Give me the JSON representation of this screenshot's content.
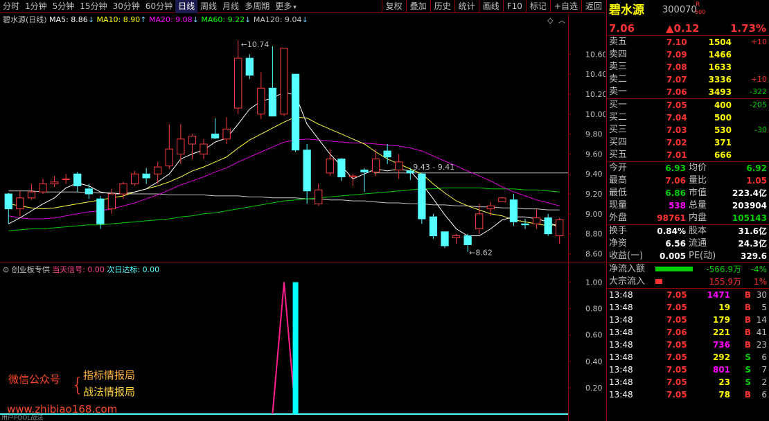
{
  "toolbar": {
    "periods": [
      "分时",
      "1分钟",
      "5分钟",
      "15分钟",
      "30分钟",
      "60分钟",
      "日线",
      "周线",
      "月线",
      "多周期",
      "更多"
    ],
    "active_period": "日线",
    "more_arrow": "▾",
    "tools": [
      "复权",
      "叠加",
      "历史",
      "统计",
      "画线",
      "F10",
      "标记",
      "+自选",
      "返回"
    ]
  },
  "main_header": {
    "stock": "碧水源(日线)",
    "ma": [
      {
        "label": "MA5: 8.86",
        "arrow": "↓",
        "color": "#ffffff"
      },
      {
        "label": "MA10: 8.90",
        "arrow": "↑",
        "color": "#ffff00"
      },
      {
        "label": "MA20: 9.08",
        "arrow": "↓",
        "color": "#ff00ff"
      },
      {
        "label": "MA60: 9.22",
        "arrow": "↓",
        "color": "#00ff00"
      },
      {
        "label": "MA120: 9.04",
        "arrow": "↓",
        "color": "#c0c0c0"
      }
    ],
    "icons": [
      "diamond-icon",
      "chevron-up-icon"
    ]
  },
  "price_axis": [
    "10.60",
    "10.40",
    "10.20",
    "10.00",
    "9.80",
    "9.60",
    "9.40",
    "9.20",
    "9.00",
    "8.80",
    "8.60"
  ],
  "annotations": {
    "high": "10.74",
    "low": "8.62",
    "mark": "9.43 - 9.41"
  },
  "indicator_header": {
    "name": "创业板专供",
    "s1": "当天信号: 0.00",
    "s2": "次日达标: 0.00"
  },
  "indicator_axis": [
    "1.00",
    "0.80",
    "0.60",
    "0.40",
    "0.20"
  ],
  "watermark": {
    "left": "微信公众号",
    "line1": "指标情报局",
    "line2": "战法情报局",
    "url": "www.zhibiao168.com",
    "bottom": "用户FOOL战法"
  },
  "chart_data": {
    "type": "candlestick",
    "ohlc": [
      [
        9.2,
        9.05,
        9.21,
        8.9
      ],
      [
        9.05,
        9.16,
        9.23,
        8.98
      ],
      [
        9.16,
        9.22,
        9.3,
        9.14
      ],
      [
        9.22,
        9.3,
        9.35,
        9.2
      ],
      [
        9.3,
        9.32,
        9.38,
        9.27
      ],
      [
        9.35,
        9.35,
        9.4,
        9.3
      ],
      [
        9.4,
        9.28,
        9.42,
        9.22
      ],
      [
        9.25,
        9.2,
        9.3,
        9.15
      ],
      [
        9.15,
        8.9,
        9.18,
        8.85
      ],
      [
        9.05,
        9.2,
        9.25,
        9.0
      ],
      [
        9.2,
        9.3,
        9.32,
        9.15
      ],
      [
        9.3,
        9.4,
        9.43,
        9.28
      ],
      [
        9.4,
        9.36,
        9.46,
        9.3
      ],
      [
        9.4,
        9.47,
        9.52,
        9.3
      ],
      [
        9.48,
        9.65,
        9.9,
        9.45
      ],
      [
        9.6,
        9.75,
        9.9,
        9.5
      ],
      [
        9.7,
        9.78,
        9.8,
        9.55
      ],
      [
        9.6,
        9.7,
        9.75,
        9.55
      ],
      [
        9.8,
        9.76,
        9.96,
        9.75
      ],
      [
        9.75,
        9.85,
        9.97,
        9.7
      ],
      [
        10.06,
        10.56,
        10.74,
        10.0
      ],
      [
        10.56,
        10.39,
        10.6,
        10.35
      ],
      [
        10.0,
        10.26,
        10.42,
        9.95
      ],
      [
        10.26,
        9.98,
        10.68,
        9.98
      ],
      [
        10.0,
        10.66,
        10.66,
        9.98
      ],
      [
        10.4,
        9.64,
        10.4,
        9.62
      ],
      [
        9.64,
        9.23,
        9.7,
        9.1
      ],
      [
        9.1,
        9.24,
        9.3,
        9.08
      ],
      [
        9.41,
        9.55,
        9.65,
        9.38
      ],
      [
        9.55,
        9.37,
        9.56,
        9.33
      ],
      [
        9.37,
        9.38,
        9.4,
        9.28
      ],
      [
        9.44,
        9.42,
        9.46,
        9.22
      ],
      [
        9.42,
        9.55,
        9.65,
        9.38
      ],
      [
        9.63,
        9.57,
        9.7,
        9.5
      ],
      [
        9.44,
        9.52,
        9.6,
        9.35
      ],
      [
        9.43,
        9.41,
        9.46,
        9.34
      ],
      [
        9.4,
        8.95,
        9.41,
        8.9
      ],
      [
        8.97,
        8.78,
        9.0,
        8.75
      ],
      [
        8.82,
        8.68,
        8.82,
        8.66
      ],
      [
        8.76,
        8.78,
        8.8,
        8.7
      ],
      [
        8.78,
        8.69,
        8.8,
        8.62
      ],
      [
        8.85,
        9.0,
        9.1,
        8.8
      ],
      [
        9.05,
        9.08,
        9.12,
        8.98
      ],
      [
        9.12,
        9.16,
        9.17,
        9.12
      ],
      [
        9.14,
        8.92,
        9.2,
        8.88
      ],
      [
        8.9,
        8.89,
        8.95,
        8.85
      ],
      [
        8.9,
        8.96,
        9.05,
        8.85
      ],
      [
        8.96,
        8.8,
        9.0,
        8.78
      ],
      [
        8.78,
        8.94,
        8.96,
        8.7
      ]
    ],
    "ma5": [
      8.9,
      8.96,
      9.03,
      9.1,
      9.16,
      9.26,
      9.31,
      9.28,
      9.22,
      9.2,
      9.2,
      9.22,
      9.25,
      9.32,
      9.4,
      9.55,
      9.6,
      9.64,
      9.72,
      9.76,
      9.9,
      10.05,
      10.13,
      10.16,
      10.22,
      10.19,
      9.9,
      9.75,
      9.6,
      9.48,
      9.35,
      9.4,
      9.45,
      9.43,
      9.45,
      9.43,
      9.3,
      9.15,
      8.99,
      8.85,
      8.78,
      8.78,
      8.85,
      8.94,
      8.97,
      8.97,
      8.95,
      8.92,
      8.86
    ],
    "ma10": [
      9.1,
      9.08,
      9.06,
      9.05,
      9.06,
      9.08,
      9.1,
      9.12,
      9.14,
      9.16,
      9.18,
      9.22,
      9.25,
      9.28,
      9.32,
      9.37,
      9.43,
      9.47,
      9.52,
      9.57,
      9.66,
      9.74,
      9.8,
      9.86,
      9.92,
      9.97,
      9.96,
      9.9,
      9.85,
      9.8,
      9.75,
      9.7,
      9.62,
      9.55,
      9.5,
      9.45,
      9.4,
      9.3,
      9.21,
      9.13,
      9.08,
      9.04,
      9.0,
      8.98,
      8.94,
      8.92,
      8.9,
      8.88,
      8.9
    ],
    "ma20": [
      8.98,
      8.96,
      8.95,
      8.95,
      8.96,
      8.98,
      9.0,
      9.02,
      9.03,
      9.05,
      9.08,
      9.11,
      9.15,
      9.19,
      9.24,
      9.29,
      9.33,
      9.37,
      9.42,
      9.46,
      9.52,
      9.57,
      9.62,
      9.67,
      9.72,
      9.74,
      9.75,
      9.74,
      9.73,
      9.72,
      9.71,
      9.71,
      9.7,
      9.69,
      9.68,
      9.66,
      9.63,
      9.58,
      9.53,
      9.48,
      9.43,
      9.38,
      9.33,
      9.27,
      9.22,
      9.18,
      9.14,
      9.11,
      9.08
    ],
    "ma60": [
      8.83,
      8.84,
      8.85,
      8.85,
      8.86,
      8.87,
      8.88,
      8.89,
      8.89,
      8.9,
      8.91,
      8.92,
      8.93,
      8.94,
      8.95,
      8.97,
      8.98,
      9.0,
      9.01,
      9.03,
      9.05,
      9.07,
      9.09,
      9.11,
      9.13,
      9.14,
      9.15,
      9.16,
      9.17,
      9.18,
      9.19,
      9.2,
      9.21,
      9.22,
      9.23,
      9.24,
      9.25,
      9.25,
      9.26,
      9.26,
      9.26,
      9.26,
      9.25,
      9.25,
      9.25,
      9.24,
      9.24,
      9.23,
      9.22
    ],
    "ma120": [
      9.23,
      9.23,
      9.23,
      9.22,
      9.22,
      9.22,
      9.22,
      9.21,
      9.21,
      9.21,
      9.2,
      9.2,
      9.2,
      9.2,
      9.19,
      9.19,
      9.19,
      9.19,
      9.18,
      9.18,
      9.18,
      9.17,
      9.17,
      9.16,
      9.16,
      9.16,
      9.15,
      9.15,
      9.14,
      9.14,
      9.13,
      9.13,
      9.12,
      9.11,
      9.11,
      9.1,
      9.1,
      9.09,
      9.09,
      9.08,
      9.08,
      9.07,
      9.07,
      9.06,
      9.06,
      9.05,
      9.05,
      9.04,
      9.04
    ],
    "price_range": [
      8.52,
      10.88
    ],
    "indicator": {
      "signal_index": 24,
      "signal_line": [
        [
          23,
          0
        ],
        [
          24,
          1.0
        ],
        [
          25,
          0
        ]
      ],
      "bar_index": 25,
      "bar_value": 1.0,
      "range": [
        0,
        1.05
      ]
    }
  },
  "quote": {
    "name": "碧水源",
    "code": "300070",
    "badge_r": "R",
    "badge_n": "500",
    "price": "7.06",
    "change": "▲0.12",
    "pct": "1.73%",
    "asks": [
      {
        "label": "卖五",
        "price": "7.10",
        "vol": "1504",
        "chg": "+10"
      },
      {
        "label": "卖四",
        "price": "7.09",
        "vol": "1466",
        "chg": ""
      },
      {
        "label": "卖三",
        "price": "7.08",
        "vol": "1633",
        "chg": ""
      },
      {
        "label": "卖二",
        "price": "7.07",
        "vol": "3336",
        "chg": "+10"
      },
      {
        "label": "卖一",
        "price": "7.06",
        "vol": "3493",
        "chg": "-322"
      }
    ],
    "bids": [
      {
        "label": "买一",
        "price": "7.05",
        "vol": "400",
        "chg": "-205"
      },
      {
        "label": "买二",
        "price": "7.04",
        "vol": "500",
        "chg": ""
      },
      {
        "label": "买三",
        "price": "7.03",
        "vol": "530",
        "chg": "-30"
      },
      {
        "label": "买四",
        "price": "7.02",
        "vol": "371",
        "chg": ""
      },
      {
        "label": "买五",
        "price": "7.01",
        "vol": "666",
        "chg": ""
      }
    ],
    "stats1": [
      [
        "今开",
        "6.93",
        "均价",
        "6.92"
      ],
      [
        "最高",
        "7.06",
        "量比",
        "1.05"
      ],
      [
        "最低",
        "6.86",
        "市值",
        "223.4亿"
      ],
      [
        "现量",
        "538",
        "总量",
        "203904"
      ],
      [
        "外盘",
        "98761",
        "内盘",
        "105143"
      ]
    ],
    "stats2": [
      [
        "换手",
        "0.84%",
        "股本",
        "31.6亿"
      ],
      [
        "净资",
        "6.56",
        "流通",
        "24.3亿"
      ],
      [
        "收益(一)",
        "0.005",
        "PE(动)",
        "329.6"
      ]
    ],
    "flow": [
      {
        "label": "净流入额",
        "value": "-566.9万",
        "pct": "-4%",
        "color": "#00d000",
        "bar": 0.85
      },
      {
        "label": "大宗流入",
        "value": "155.9万",
        "pct": "1%",
        "color": "#ff3232",
        "bar": 0.15
      }
    ],
    "ticks": [
      {
        "time": "13:48",
        "price": "7.05",
        "vol": "1471",
        "bs": "B",
        "n": "30"
      },
      {
        "time": "13:48",
        "price": "7.05",
        "vol": "19",
        "bs": "B",
        "n": "5"
      },
      {
        "time": "13:48",
        "price": "7.05",
        "vol": "179",
        "bs": "B",
        "n": "14"
      },
      {
        "time": "13:48",
        "price": "7.06",
        "vol": "221",
        "bs": "B",
        "n": "41"
      },
      {
        "time": "13:48",
        "price": "7.05",
        "vol": "736",
        "bs": "B",
        "n": "23"
      },
      {
        "time": "13:48",
        "price": "7.05",
        "vol": "292",
        "bs": "S",
        "n": "6"
      },
      {
        "time": "13:48",
        "price": "7.05",
        "vol": "801",
        "bs": "S",
        "n": "7"
      },
      {
        "time": "13:48",
        "price": "7.05",
        "vol": "23",
        "bs": "S",
        "n": "2"
      },
      {
        "time": "13:48",
        "price": "7.05",
        "vol": "78",
        "bs": "B",
        "n": "6"
      }
    ]
  }
}
